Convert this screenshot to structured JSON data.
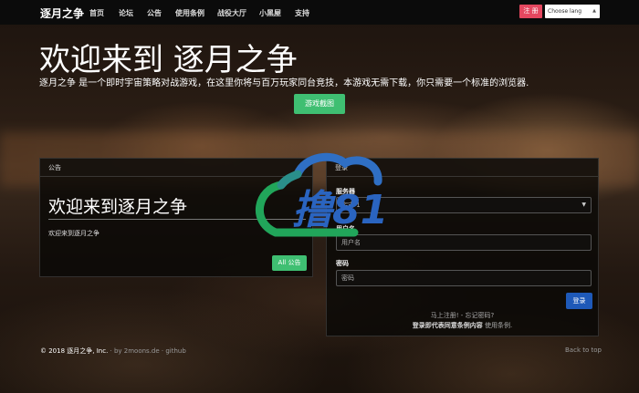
{
  "brand": "逐月之争",
  "nav": {
    "items": [
      {
        "label": "首页"
      },
      {
        "label": "论坛"
      },
      {
        "label": "公告"
      },
      {
        "label": "使用条例"
      },
      {
        "label": "战役大厅"
      },
      {
        "label": "小黑屋"
      },
      {
        "label": "支持"
      }
    ],
    "register_label": "注 册",
    "lang_placeholder": "Choose lang"
  },
  "hero": {
    "title": "欢迎来到 逐月之争",
    "subtitle": "逐月之争 是一个即时宇宙策略对战游戏，在这里你将与百万玩家同台竞技，本游戏无需下载，你只需要一个标准的浏览器.",
    "screenshot_button": "游戏截图"
  },
  "announcements": {
    "header": "公告",
    "title": "欢迎来到逐月之争",
    "text": "欢迎来到逐月之争",
    "all_button": "All 公告"
  },
  "login": {
    "header": "登录",
    "server_label": "服务器",
    "server_value": "宇宙 1",
    "username_label": "用户名",
    "username_placeholder": "用户名",
    "password_label": "密码",
    "password_placeholder": "密码",
    "submit_label": "登录",
    "register_link": "马上注册!",
    "separator": " - ",
    "forgot_link": "忘记密码?",
    "terms_bold": "登录即代表同意条例内容",
    "terms_link": " 使用条例."
  },
  "footer": {
    "copyright": "© 2018 逐月之争, Inc.",
    "credit_prefix": " · by 2moons.de · ",
    "github": "github",
    "back_to_top": "Back to top"
  },
  "watermark": {
    "text": "撸81"
  },
  "colors": {
    "accent_green": "#3fbf72",
    "register_red": "#e4475f",
    "login_blue": "#1e59b8"
  }
}
